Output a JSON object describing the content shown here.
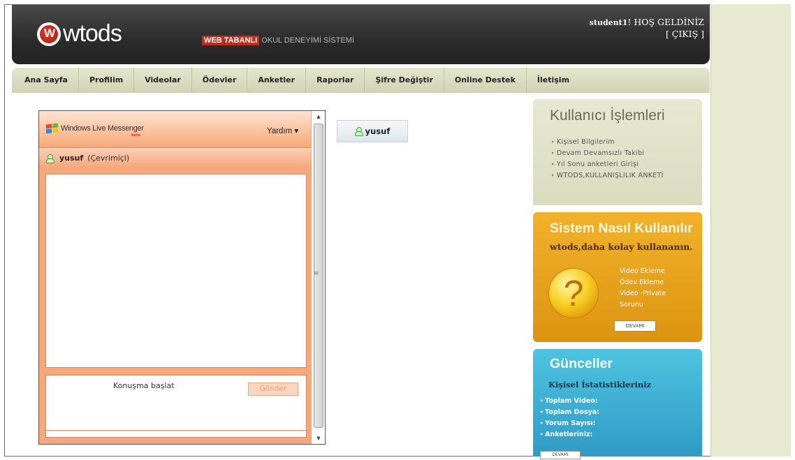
{
  "header": {
    "logo_mark": "W",
    "logo_text": "wtods",
    "tagline_highlight": "WEB TABANLI",
    "tagline_rest": "OKUL DENEYİMİ SİSTEMİ",
    "username": "student1",
    "welcome_text": "! HOŞ GELDİNİZ",
    "logout_label": "[ ÇIKIŞ ]"
  },
  "nav": {
    "items": [
      {
        "label": "Ana Sayfa"
      },
      {
        "label": "Profilim"
      },
      {
        "label": "Videolar"
      },
      {
        "label": "Ödevler"
      },
      {
        "label": "Anketler"
      },
      {
        "label": "Raporlar"
      },
      {
        "label": "Şifre Değiştir"
      },
      {
        "label": "Online Destek"
      },
      {
        "label": "İletişim"
      }
    ]
  },
  "messenger": {
    "brand": "Windows Live Messenger",
    "beta": "beta",
    "help_label": "Yardım ▾",
    "contact_name": "yusuf",
    "contact_status": "(Çevrimiçi)",
    "input_placeholder": "Konuşma başlat",
    "send_label": "Gönder",
    "colors": {
      "accent": "#f6a87a"
    }
  },
  "contact_tab": {
    "name": "yusuf"
  },
  "user_box": {
    "title": "Kullanıcı İşlemleri",
    "items": [
      {
        "label": "Kişisel Bilgilerim"
      },
      {
        "label": "Devam Devamsızlı Takibi"
      },
      {
        "label": "Yıl Sonu anketleri Girişi"
      },
      {
        "label": "WTODS,KULLANIŞLILIK ANKETİ"
      }
    ]
  },
  "help_box": {
    "title": "Sistem Nasıl Kullanılır",
    "subtitle": "wtods,daha kolay kullananın.",
    "icon": "?",
    "items": [
      {
        "label": "Video Ekleme"
      },
      {
        "label": "Ödev Ekleme"
      },
      {
        "label": "Video -Private"
      },
      {
        "label": "Sorunu"
      }
    ],
    "more_label": "DEVAMI"
  },
  "news_box": {
    "title": "Günceller",
    "subtitle": "Kişisel İstatistikleriniz",
    "items": [
      {
        "label": "Toplam Video:"
      },
      {
        "label": "Toplam Dosya:"
      },
      {
        "label": "Yorum Sayısı:"
      },
      {
        "label": "Anketleriniz:"
      }
    ],
    "more_label": "DEVAMI"
  }
}
